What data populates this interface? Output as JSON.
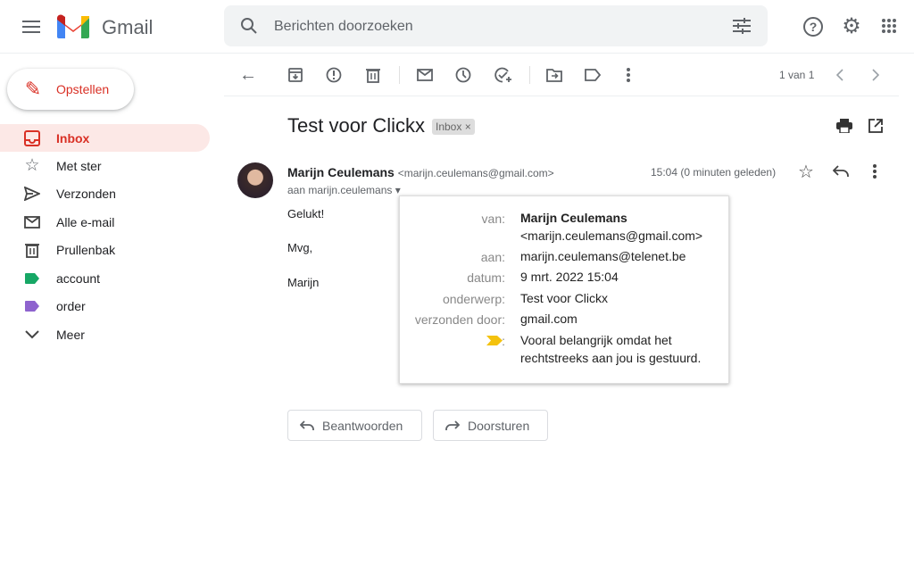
{
  "app": {
    "name": "Gmail"
  },
  "search": {
    "placeholder": "Berichten doorzoeken"
  },
  "compose": {
    "label": "Opstellen"
  },
  "sidebar": {
    "items": [
      {
        "label": "Inbox",
        "icon": "inbox-icon"
      },
      {
        "label": "Met ster",
        "icon": "star-icon"
      },
      {
        "label": "Verzonden",
        "icon": "send-icon"
      },
      {
        "label": "Alle e-mail",
        "icon": "mail-icon"
      },
      {
        "label": "Prullenbak",
        "icon": "trash-icon"
      },
      {
        "label": "account",
        "icon": "label-icon",
        "color": "#16a765"
      },
      {
        "label": "order",
        "icon": "label-icon",
        "color": "#8e63ce"
      },
      {
        "label": "Meer",
        "icon": "chevron-down-icon"
      }
    ]
  },
  "toolbar": {
    "pagination": "1 van 1"
  },
  "email": {
    "subject": "Test voor Clickx",
    "label_chip": "Inbox",
    "sender_name": "Marijn Ceulemans",
    "sender_email": "<marijn.ceulemans@gmail.com>",
    "time": "15:04 (0 minuten geleden)",
    "to": "aan marijn.ceulemans",
    "body": [
      "Gelukt!",
      "Mvg,",
      "Marijn"
    ]
  },
  "details": {
    "van_label": "van:",
    "van_name": "Marijn Ceulemans",
    "van_email": "<marijn.ceulemans@gmail.com>",
    "aan_label": "aan:",
    "aan": "marijn.ceulemans@telenet.be",
    "datum_label": "datum:",
    "datum": "9 mrt. 2022 15:04",
    "onderwerp_label": "onderwerp:",
    "onderwerp": "Test voor Clickx",
    "verzonden_label": "verzonden door:",
    "verzonden": "gmail.com",
    "importance_label": ":",
    "importance": "Vooral belangrijk omdat het rechtstreeks aan jou is gestuurd.",
    "importance_color": "#f4c20d"
  },
  "actions": {
    "reply": "Beantwoorden",
    "forward": "Doorsturen"
  }
}
